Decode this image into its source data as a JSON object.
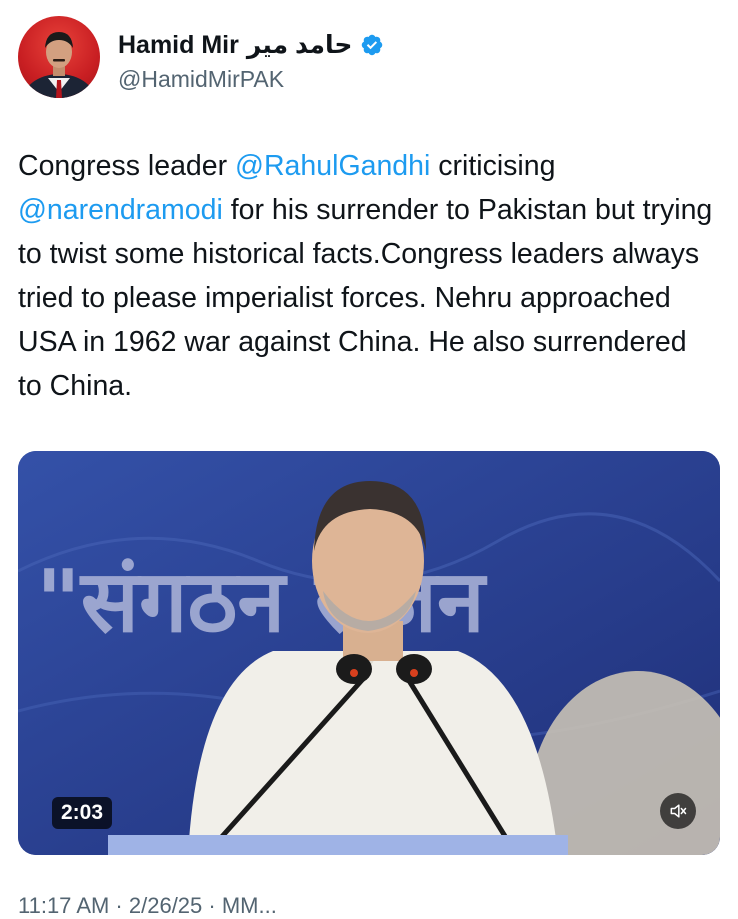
{
  "author": {
    "display_name": "Hamid Mir",
    "display_name_urdu": "حامد میر",
    "handle": "@HamidMirPAK",
    "verified": true
  },
  "tweet": {
    "segments": [
      {
        "type": "text",
        "value": "Congress leader "
      },
      {
        "type": "mention",
        "value": "@RahulGandhi"
      },
      {
        "type": "text",
        "value": " criticising "
      },
      {
        "type": "mention",
        "value": "@narendramodi"
      },
      {
        "type": "text",
        "value": " for his surrender to Pakistan but trying to twist some historical facts.Congress leaders always tried to please imperialist forces. Nehru approached USA in 1962 war against China. He also surrendered to China."
      }
    ]
  },
  "media": {
    "banner_text": "\"संगठन सृजन",
    "video_duration": "2:03",
    "mute_icon": "speaker-muted-icon"
  },
  "footer": {
    "timestamp_partial": "11:17 AM · 2/26/25 · MM..."
  },
  "colors": {
    "accent": "#1d9bf0",
    "text": "#0f1419",
    "muted": "#536471",
    "banner_blue": "#2a3f8f"
  }
}
